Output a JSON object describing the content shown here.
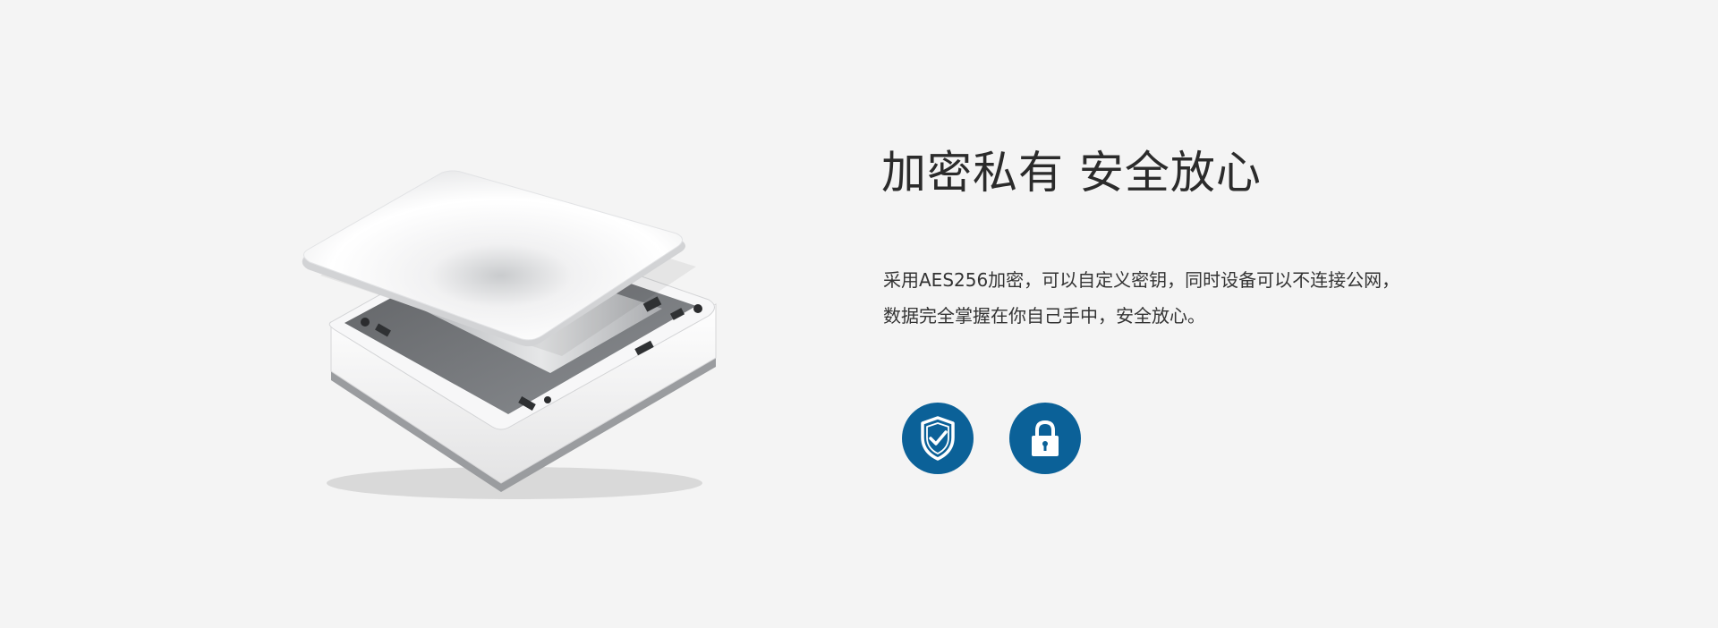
{
  "section": {
    "title": "加密私有 安全放心",
    "description_lines": [
      "采用AES256加密，可以自定义密钥，同时设备可以不连接公网，",
      "数据完全掌握在你自己手中，安全放心。"
    ]
  },
  "product_image": {
    "name": "mini-pc-open-lid"
  },
  "features": [
    {
      "icon": "shield-check-icon"
    },
    {
      "icon": "lock-icon"
    }
  ],
  "colors": {
    "background": "#f4f4f4",
    "accent": "#0b6198",
    "title": "#2b2b2b",
    "text": "#333333"
  }
}
